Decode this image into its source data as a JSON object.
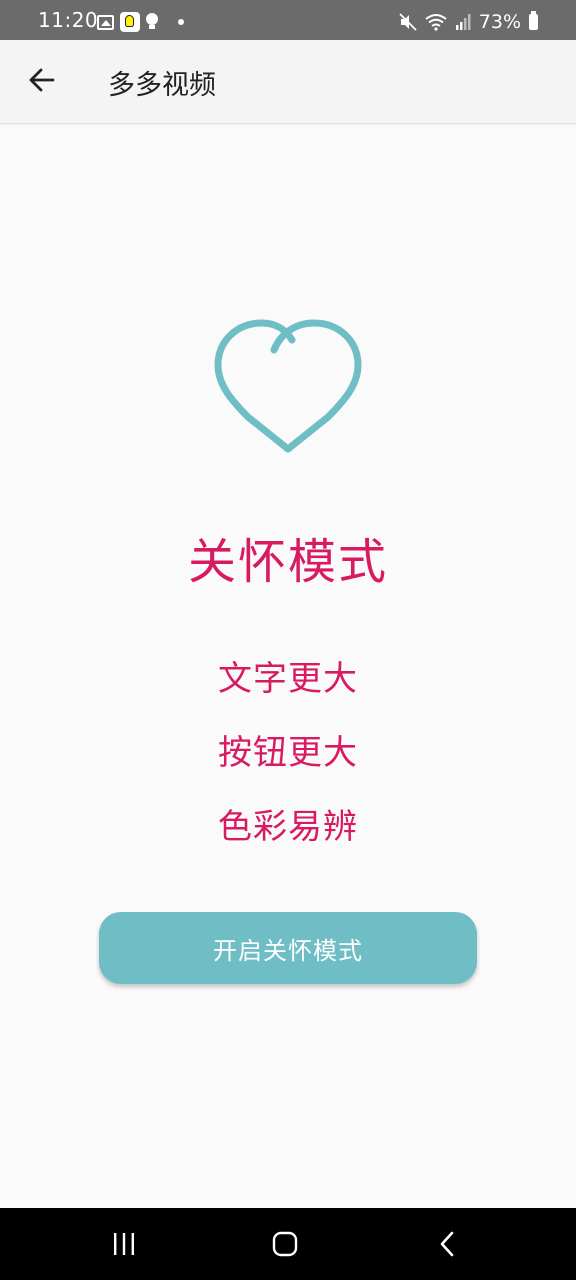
{
  "status_bar": {
    "time": "11:20",
    "battery_percent": "73%",
    "left_icons": [
      "image-icon",
      "snapchat-icon",
      "bulb-icon",
      "dot-icon"
    ],
    "right_icons": [
      "mute-icon",
      "wifi-icon",
      "signal-icon",
      "battery-icon"
    ]
  },
  "app_bar": {
    "title": "多多视频",
    "back_icon": "arrow-left-icon"
  },
  "content": {
    "icon": "heart-icon",
    "title": "关怀模式",
    "features": [
      "文字更大",
      "按钮更大",
      "色彩易辨"
    ],
    "button_label": "开启关怀模式"
  },
  "nav_bar": {
    "buttons": [
      "recent-apps-icon",
      "home-icon",
      "back-icon"
    ]
  },
  "colors": {
    "accent_text": "#d81b60",
    "heart": "#6fbec5",
    "button_bg": "#6fbec5",
    "button_text": "#ffffff",
    "background": "#fafafa",
    "status_bar_bg": "#6b6b6b",
    "nav_bar_bg": "#000000"
  }
}
